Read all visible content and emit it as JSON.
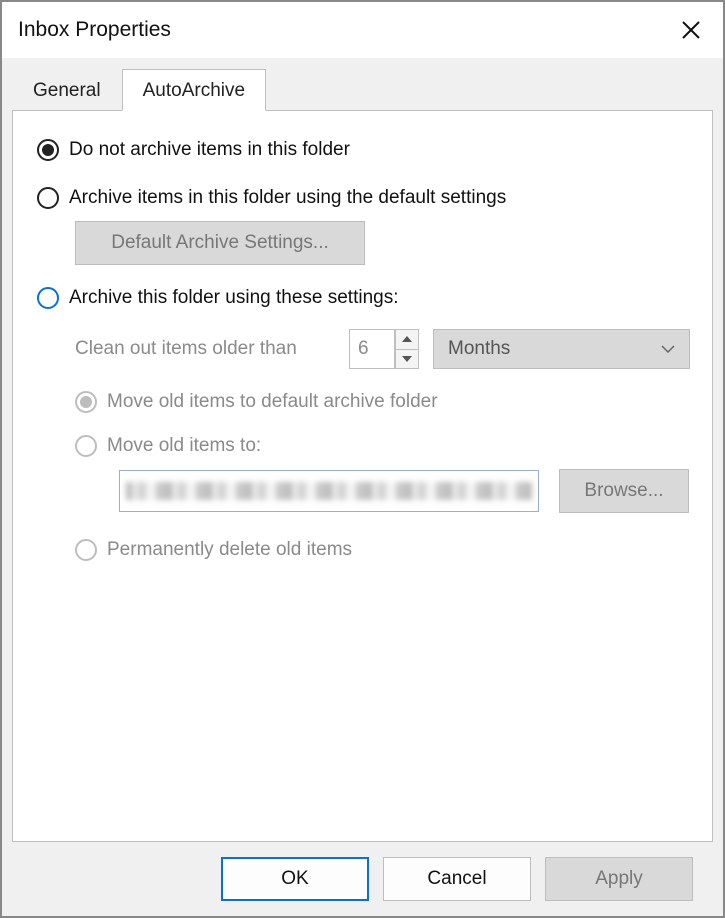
{
  "titlebar": {
    "title": "Inbox Properties"
  },
  "tabs": [
    {
      "id": "general",
      "label": "General",
      "active": false
    },
    {
      "id": "autoarchive",
      "label": "AutoArchive",
      "active": true
    }
  ],
  "options": {
    "do_not_archive": {
      "label": "Do not archive items in this folder",
      "selected": true
    },
    "default_archive": {
      "label": "Archive items in this folder using the default settings",
      "selected": false,
      "button": "Default Archive Settings..."
    },
    "custom_archive": {
      "label": "Archive this folder using these settings:",
      "selected": false,
      "cleanout_label": "Clean out items older than",
      "cleanout_value": "6",
      "cleanout_unit": "Months",
      "sub": {
        "move_default": {
          "label": "Move old items to default archive folder",
          "selected": true
        },
        "move_to": {
          "label": "Move old items to:",
          "selected": false,
          "browse": "Browse..."
        },
        "perm_delete": {
          "label": "Permanently delete old items",
          "selected": false
        }
      }
    }
  },
  "buttons": {
    "ok": "OK",
    "cancel": "Cancel",
    "apply": "Apply"
  }
}
